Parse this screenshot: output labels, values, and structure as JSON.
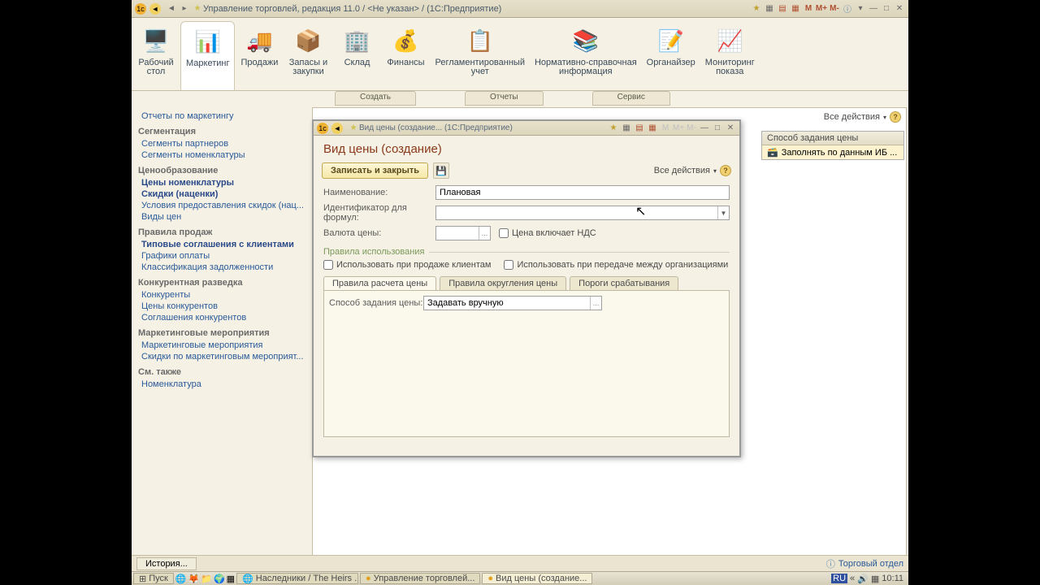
{
  "titlebar": {
    "title": "Управление торговлей, редакция 11.0 / <Не указан> / (1С:Предприятие)"
  },
  "ribbon": {
    "items": [
      {
        "label": "Рабочий\nстол",
        "icon": "🖥️"
      },
      {
        "label": "Маркетинг",
        "icon": "📊"
      },
      {
        "label": "Продажи",
        "icon": "🚚"
      },
      {
        "label": "Запасы и\nзакупки",
        "icon": "📦"
      },
      {
        "label": "Склад",
        "icon": "🏢"
      },
      {
        "label": "Финансы",
        "icon": "💰"
      },
      {
        "label": "Регламентированный\nучет",
        "icon": "📋"
      },
      {
        "label": "Нормативно-справочная\nинформация",
        "icon": "📚"
      },
      {
        "label": "Органайзер",
        "icon": "📝"
      },
      {
        "label": "Мониторинг\nпоказа",
        "icon": "📈"
      }
    ]
  },
  "topTabs": {
    "create": "Создать",
    "reports": "Отчеты",
    "service": "Сервис"
  },
  "sidebar": {
    "top": "Отчеты по маркетингу",
    "groups": [
      {
        "head": "Сегментация",
        "items": [
          "Сегменты партнеров",
          "Сегменты номенклатуры"
        ]
      },
      {
        "head": "Ценообразование",
        "items": [
          "Цены номенклатуры",
          "Скидки (наценки)",
          "Условия предоставления скидок (нац...",
          "Виды цен"
        ],
        "bold": [
          0,
          1
        ]
      },
      {
        "head": "Правила продаж",
        "items": [
          "Типовые соглашения с клиентами",
          "Графики оплаты",
          "Классификация задолженности"
        ],
        "bold": [
          0
        ]
      },
      {
        "head": "Конкурентная разведка",
        "items": [
          "Конкуренты",
          "Цены конкурентов",
          "Соглашения конкурентов"
        ]
      },
      {
        "head": "Маркетинговые мероприятия",
        "items": [
          "Маркетинговые мероприятия",
          "Скидки по маркетинговым мероприят..."
        ]
      },
      {
        "head": "См. также",
        "items": [
          "Номенклатура"
        ]
      }
    ]
  },
  "content": {
    "allActions": "Все действия",
    "listHead": "Способ задания цены",
    "listRow": "Заполнять по данным ИБ ..."
  },
  "dialog": {
    "windowTitle": "Вид цены (создание... (1С:Предприятие)",
    "title": "Вид цены (создание)",
    "saveAndClose": "Записать и закрыть",
    "allActions": "Все действия",
    "labels": {
      "name": "Наименование:",
      "formula": "Идентификатор для формул:",
      "currency": "Валюта цены:",
      "vat": "Цена включает НДС"
    },
    "values": {
      "name": "Плановая",
      "formula": "",
      "currency": ""
    },
    "fieldset": "Правила использования",
    "checks": {
      "sell": "Использовать при продаже клиентам",
      "transfer": "Использовать при передаче между организациями"
    },
    "tabs": {
      "calc": "Правила расчета цены",
      "round": "Правила округления цены",
      "thresh": "Пороги срабатывания"
    },
    "tabContent": {
      "methodLabel": "Способ задания цены:",
      "methodValue": "Задавать вручную"
    }
  },
  "footer": {
    "history": "История...",
    "dept": "Торговый отдел"
  },
  "taskbar": {
    "start": "Пуск",
    "items": [
      "Наследники / The Heirs ...",
      "Управление торговлей...",
      "Вид цены (создание..."
    ],
    "lang": "RU",
    "time": "10:11"
  }
}
